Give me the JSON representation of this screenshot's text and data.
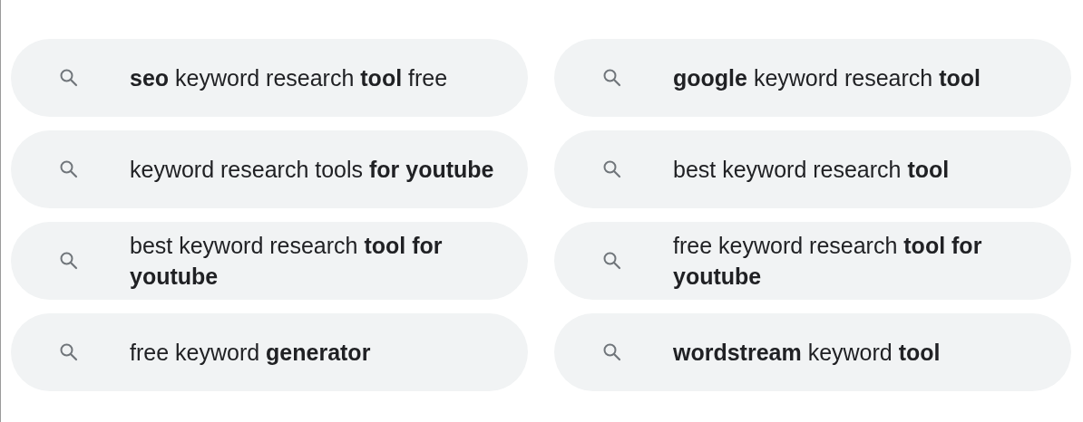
{
  "suggestions": [
    {
      "text": "**seo** keyword research **tool** free"
    },
    {
      "text": "**google** keyword research **tool**"
    },
    {
      "text": "keyword research tools **for youtube**"
    },
    {
      "text": "best keyword research **tool**"
    },
    {
      "text": "best keyword research **tool for youtube**"
    },
    {
      "text": "free keyword research **tool for youtube**"
    },
    {
      "text": "free keyword **generator**"
    },
    {
      "text": "**wordstream** keyword **tool**"
    }
  ]
}
